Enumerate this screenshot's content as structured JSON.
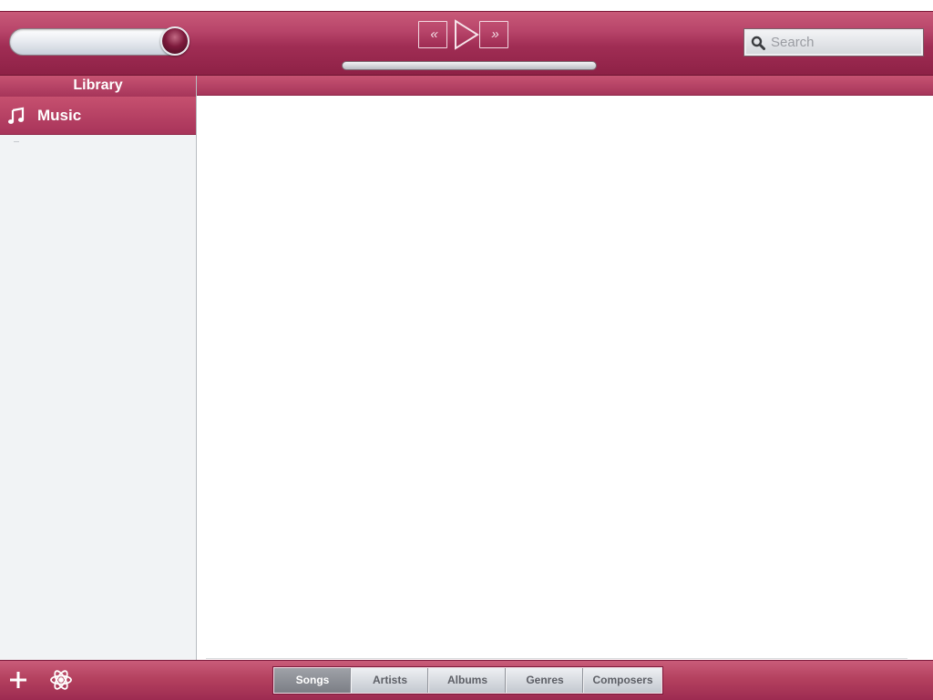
{
  "toolbar": {
    "prev_icon": "rewind-icon",
    "play_icon": "play-icon",
    "next_icon": "fast-forward-icon",
    "prev_glyph": "«",
    "next_glyph": "»",
    "search": {
      "placeholder": "Search",
      "value": ""
    }
  },
  "sidebar": {
    "header": "Library",
    "items": [
      {
        "label": "Music",
        "icon": "music-note-icon",
        "selected": true
      }
    ]
  },
  "bottom_bar": {
    "add_icon": "plus-icon",
    "settings_icon": "atom-icon",
    "tabs": [
      {
        "label": "Songs",
        "selected": true
      },
      {
        "label": "Artists",
        "selected": false
      },
      {
        "label": "Albums",
        "selected": false
      },
      {
        "label": "Genres",
        "selected": false
      },
      {
        "label": "Composers",
        "selected": false
      }
    ]
  },
  "colors": {
    "accent": "#a6355a",
    "accent_light": "#c75372",
    "sidebar_bg": "#f1f3f5",
    "selected_segment": "#8d9096"
  }
}
